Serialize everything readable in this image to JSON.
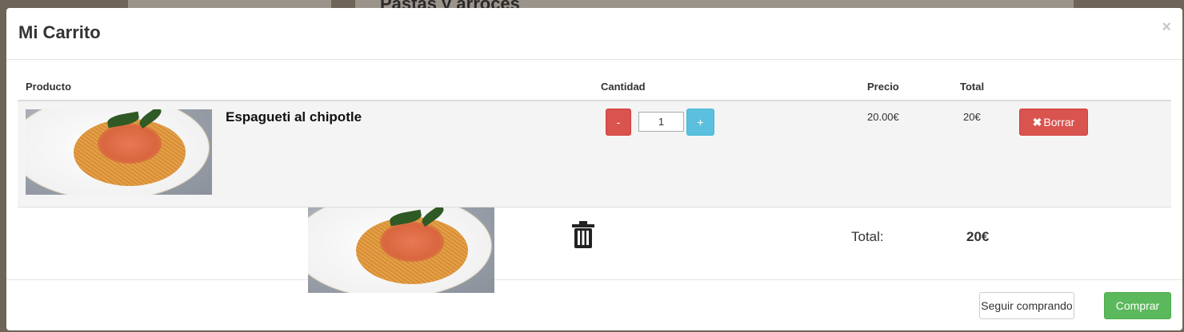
{
  "background": {
    "heading": "Pastas y arroces"
  },
  "modal": {
    "title": "Mi Carrito",
    "close_label": "×"
  },
  "table": {
    "headers": {
      "product": "Producto",
      "quantity": "Cantidad",
      "price": "Precio",
      "total": "Total"
    },
    "rows": [
      {
        "name": "Espagueti al chipotle",
        "image": "spaghetti-plate-image",
        "minus_label": "-",
        "quantity": "1",
        "plus_label": "+",
        "price": "20.00€",
        "total": "20€",
        "delete_label": "Borrar",
        "delete_icon": "times-icon"
      }
    ]
  },
  "summary": {
    "dragged_image": "spaghetti-plate-image",
    "trash_icon": "trash-icon",
    "total_label": "Total:",
    "total_value": "20€"
  },
  "footer": {
    "continue_label": "Seguir comprando",
    "buy_label": "Comprar"
  },
  "colors": {
    "danger": "#d9534f",
    "info": "#5bc0de",
    "success": "#5cb85c"
  }
}
